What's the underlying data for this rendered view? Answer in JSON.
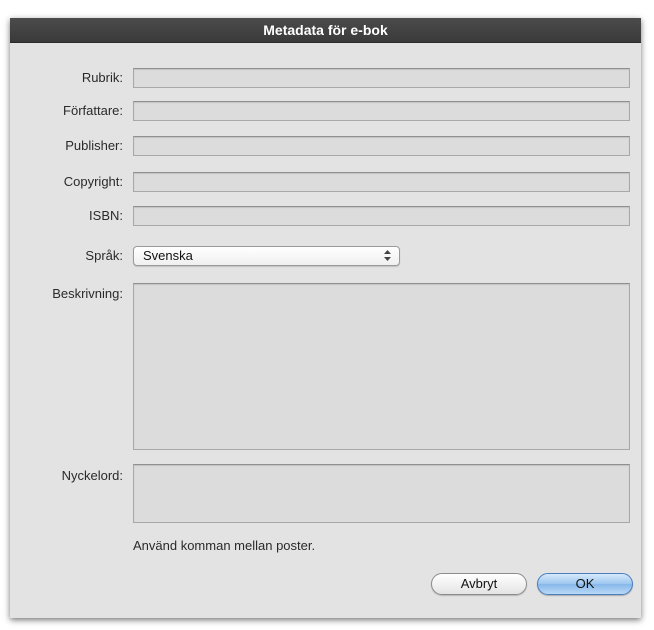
{
  "dialog": {
    "title": "Metadata för e-bok"
  },
  "fields": {
    "title_label": "Rubrik:",
    "title_value": "",
    "author_label": "Författare:",
    "author_value": "",
    "publisher_label": "Publisher:",
    "publisher_value": "",
    "copyright_label": "Copyright:",
    "copyright_value": "",
    "isbn_label": "ISBN:",
    "isbn_value": "",
    "language_label": "Språk:",
    "language_value": "Svenska",
    "description_label": "Beskrivning:",
    "description_value": "",
    "keywords_label": "Nyckelord:",
    "keywords_value": "",
    "keywords_hint": "Använd komman mellan poster."
  },
  "buttons": {
    "cancel_label": "Avbryt",
    "ok_label": "OK"
  },
  "icons": {
    "language_select": "updown-arrows-icon"
  }
}
